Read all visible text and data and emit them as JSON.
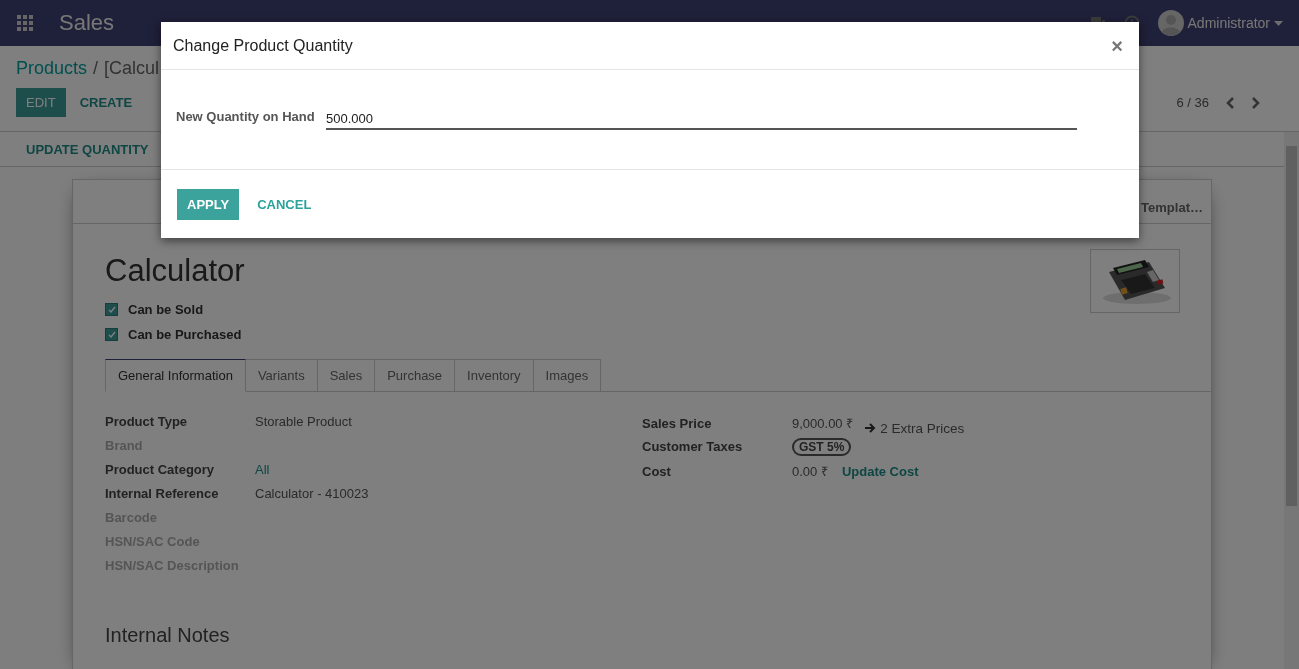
{
  "navbar": {
    "app_name": "Sales",
    "user": "Administrator"
  },
  "control_panel": {
    "breadcrumb": [
      "Products",
      "/",
      "[Calcul"
    ],
    "buttons": [
      "EDIT",
      "CREATE"
    ],
    "pager": "6 / 36"
  },
  "status_bar": {
    "buttons": [
      "UPDATE QUANTITY"
    ]
  },
  "form": {
    "button_box": [
      "Templat…"
    ],
    "name": "Calculator",
    "checkboxes": [
      {
        "label": "Can be Sold",
        "checked": true
      },
      {
        "label": "Can be Purchased",
        "checked": true
      }
    ],
    "tabs": [
      {
        "label": "General Information",
        "selected": true
      },
      {
        "label": "Variants",
        "selected": false
      },
      {
        "label": "Sales",
        "selected": false
      },
      {
        "label": "Purchase",
        "selected": false
      },
      {
        "label": "Inventory",
        "selected": false
      },
      {
        "label": "Images",
        "selected": false
      }
    ],
    "left_fields": [
      {
        "label": "Product Type",
        "value": "Storable Product",
        "kind": "text",
        "disabled": false
      },
      {
        "label": "Brand",
        "disabled": true
      },
      {
        "label": "Product Category",
        "value": "All",
        "kind": "link",
        "disabled": false
      },
      {
        "label": "Internal Reference",
        "value": "Calculator - 410023",
        "kind": "text",
        "disabled": false
      },
      {
        "label": "Barcode",
        "disabled": true
      },
      {
        "label": "HSN/SAC Code",
        "disabled": true
      },
      {
        "label": "HSN/SAC Description",
        "disabled": true
      }
    ],
    "sales_price": {
      "label": "Sales Price",
      "value": "9,000.00 ₹",
      "extra": "2 Extra Prices"
    },
    "customer_taxes": {
      "label": "Customer Taxes",
      "tag": "GST 5%"
    },
    "cost": {
      "label": "Cost",
      "value": "0.00 ₹",
      "link": "Update Cost"
    },
    "section_title": "Internal Notes"
  },
  "dialog": {
    "title": "Change Product Quantity",
    "close": "×",
    "field_label": "New Quantity on Hand",
    "field_value": "500.000",
    "buttons": [
      {
        "label": "APPLY",
        "kind": "primary"
      },
      {
        "label": "CANCEL",
        "kind": "link"
      }
    ]
  }
}
